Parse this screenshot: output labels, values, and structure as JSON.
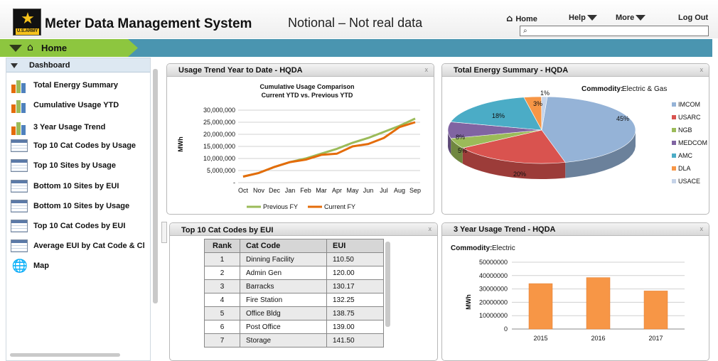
{
  "header": {
    "app_title": "Meter Data Management System",
    "notional": "Notional – Not real data",
    "logo_text": "U.S.ARMY",
    "nav": {
      "home": "Home",
      "help": "Help",
      "more": "More",
      "logout": "Log Out"
    },
    "search_placeholder": ""
  },
  "breadcrumb": {
    "label": "Home"
  },
  "sidebar": {
    "section_label": "Dashboard",
    "items": [
      {
        "label": "Total Energy Summary",
        "icon": "bar-chart-icon"
      },
      {
        "label": "Cumulative Usage YTD",
        "icon": "bar-chart-icon"
      },
      {
        "label": "3 Year Usage Trend",
        "icon": "bar-chart-icon"
      },
      {
        "label": "Top 10 Cat Codes by Usage",
        "icon": "table-icon"
      },
      {
        "label": "Top 10 Sites by Usage",
        "icon": "table-icon"
      },
      {
        "label": "Bottom 10 Sites by EUI",
        "icon": "table-icon"
      },
      {
        "label": "Bottom 10 Sites by Usage",
        "icon": "table-icon"
      },
      {
        "label": "Top 10 Cat Codes by EUI",
        "icon": "table-icon"
      },
      {
        "label": "Average EUI by Cat Code & Cl",
        "icon": "table-icon"
      },
      {
        "label": "Map",
        "icon": "globe-icon"
      }
    ]
  },
  "panels": {
    "usage_trend": {
      "title": "Usage Trend Year to Date - HQDA",
      "close": "x"
    },
    "energy_summary": {
      "title": "Total Energy Summary - HQDA",
      "close": "x",
      "commodity_label": "Commodity:",
      "commodity_value": "Electric & Gas"
    },
    "cat_codes": {
      "title": "Top 10 Cat Codes by EUI",
      "close": "x"
    },
    "three_year": {
      "title": "3 Year Usage Trend - HQDA",
      "close": "x",
      "commodity_label": "Commodity:",
      "commodity_value": "Electric"
    }
  },
  "table": {
    "headers": [
      "Rank",
      "Cat Code",
      "EUI"
    ],
    "rows": [
      [
        "1",
        "Dinning Facility",
        "110.50"
      ],
      [
        "2",
        "Admin Gen",
        "120.00"
      ],
      [
        "3",
        "Barracks",
        "130.17"
      ],
      [
        "4",
        "Fire Station",
        "132.25"
      ],
      [
        "5",
        "Office Bldg",
        "138.75"
      ],
      [
        "6",
        "Post Office",
        "139.00"
      ],
      [
        "7",
        "Storage",
        "141.50"
      ]
    ]
  },
  "colors": {
    "previous_fy": "#9bbb59",
    "current_fy": "#e46c0a",
    "bar": "#f79646",
    "breadcrumb_bar": "#4a95b0",
    "breadcrumb_home": "#8dc63f"
  },
  "chart_data": [
    {
      "type": "line",
      "title": "Cumulative Usage Comparison",
      "subtitle": "Current YTD vs. Previous YTD",
      "ylabel": "MWh",
      "xlabel": "",
      "categories": [
        "Oct",
        "Nov",
        "Dec",
        "Jan",
        "Feb",
        "Mar",
        "Apr",
        "May",
        "Jun",
        "Jul",
        "Aug",
        "Sep"
      ],
      "y_ticks": [
        "30,000,000",
        "25,000,000",
        "20,000,000",
        "15,000,000",
        "10,000,000",
        "5,000,000",
        "-"
      ],
      "ylim": [
        0,
        30000000
      ],
      "series": [
        {
          "name": "Previous FY",
          "values": [
            2500000,
            4000000,
            6500000,
            8500000,
            10000000,
            12000000,
            14000000,
            16500000,
            18500000,
            21000000,
            23500000,
            26500000
          ]
        },
        {
          "name": "Current FY",
          "values": [
            2500000,
            4000000,
            6500000,
            8500000,
            9500000,
            11500000,
            12000000,
            15000000,
            16000000,
            18500000,
            23000000,
            25000000
          ]
        }
      ],
      "legend": "bottom",
      "grid": true
    },
    {
      "type": "pie",
      "title": "",
      "labels": [
        "IMCOM",
        "USARC",
        "NGB",
        "MEDCOM",
        "AMC",
        "DLA",
        "USACE"
      ],
      "values": [
        45,
        20,
        5,
        8,
        18,
        3,
        1
      ],
      "colors": [
        "#95b3d7",
        "#d9534f",
        "#9bbb59",
        "#8064a2",
        "#4bacc6",
        "#f79646",
        "#c5d3e8"
      ],
      "legend": "right"
    },
    {
      "type": "bar",
      "title": "",
      "ylabel": "MWh",
      "categories": [
        "2015",
        "2016",
        "2017"
      ],
      "values": [
        34000000,
        38500000,
        28500000
      ],
      "y_ticks": [
        "50000000",
        "40000000",
        "30000000",
        "20000000",
        "10000000",
        "0"
      ],
      "ylim": [
        0,
        50000000
      ],
      "grid": true
    }
  ]
}
